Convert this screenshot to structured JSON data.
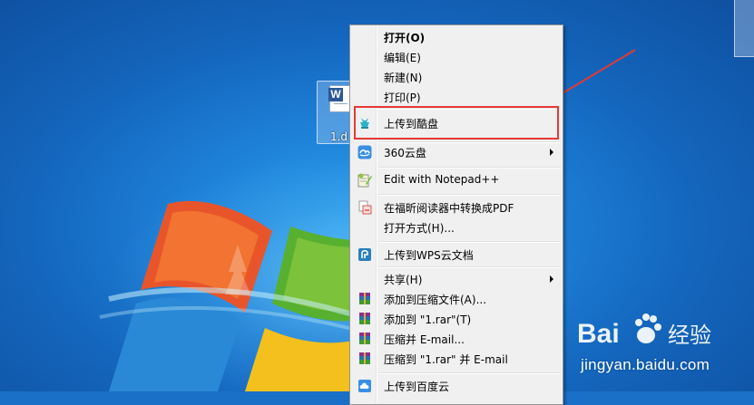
{
  "desktop": {
    "file_icon_label": "1.d",
    "file_icon_letter": "W"
  },
  "context_menu": {
    "items": [
      {
        "label": "打开(O)",
        "icon": "none",
        "bold": true
      },
      {
        "label": "编辑(E)",
        "icon": "none"
      },
      {
        "label": "新建(N)",
        "icon": "none"
      },
      {
        "label": "打印(P)",
        "icon": "none"
      },
      {
        "label": "上传到酷盘",
        "icon": "kupan-icon",
        "highlighted": true
      },
      {
        "label": "360云盘",
        "icon": "cloud-360-icon",
        "submenu": true
      },
      {
        "label": "Edit with Notepad++",
        "icon": "notepad-plus-icon"
      },
      {
        "label": "在福昕阅读器中转换成PDF",
        "icon": "foxit-pdf-icon"
      },
      {
        "label": "打开方式(H)...",
        "icon": "none"
      },
      {
        "label": "上传到WPS云文档",
        "icon": "wps-cloud-icon"
      },
      {
        "label": "共享(H)",
        "icon": "none",
        "submenu": true
      },
      {
        "label": "添加到压缩文件(A)...",
        "icon": "winrar-icon"
      },
      {
        "label": "添加到 \"1.rar\"(T)",
        "icon": "winrar-icon"
      },
      {
        "label": "压缩并 E-mail...",
        "icon": "winrar-icon"
      },
      {
        "label": "压缩到 \"1.rar\" 并 E-mail",
        "icon": "winrar-icon"
      },
      {
        "label": "上传到百度云",
        "icon": "baidu-cloud-icon"
      }
    ]
  },
  "watermark": {
    "brand": "Bai",
    "brand2": "经验",
    "url": "jingyan.baidu.com"
  },
  "colors": {
    "highlight_box": "#e53935",
    "menu_bg": "#f0f0f0"
  }
}
